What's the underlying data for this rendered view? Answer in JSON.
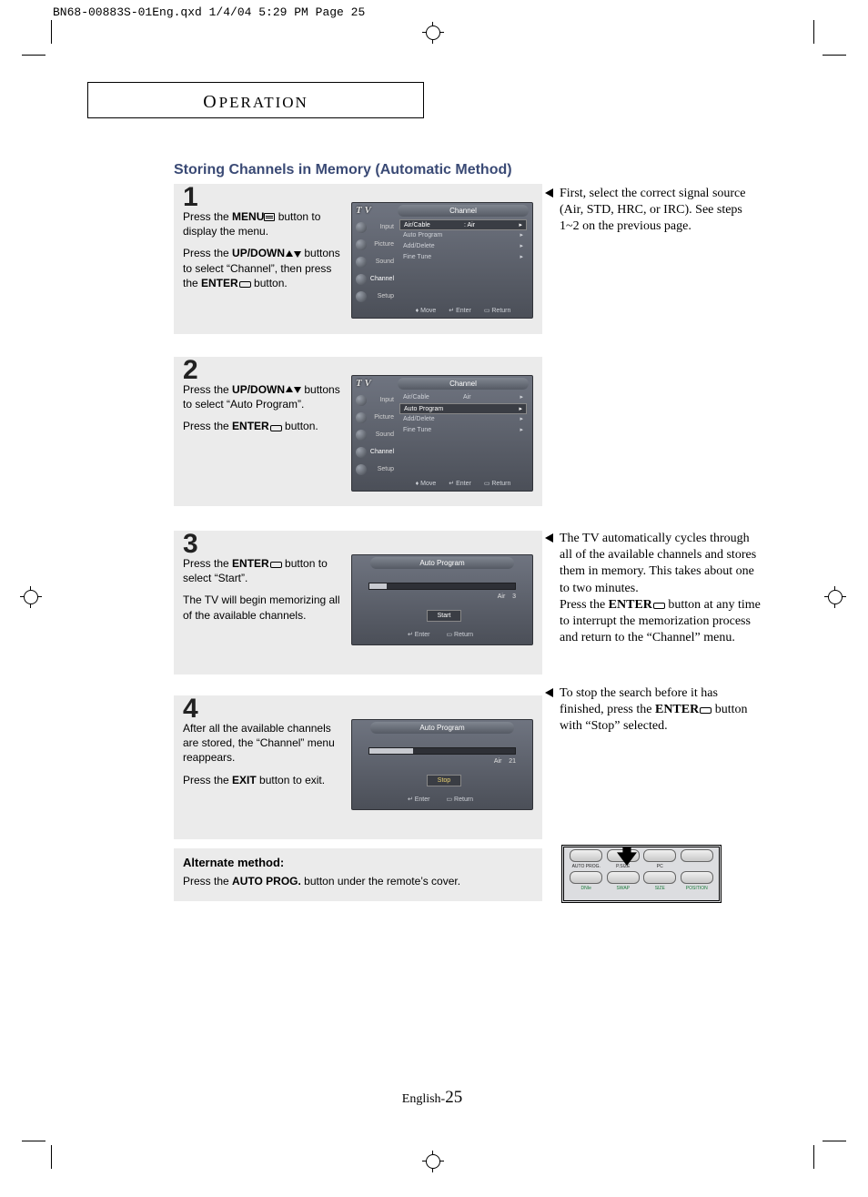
{
  "slug": "BN68-00883S-01Eng.qxd  1/4/04 5:29 PM  Page 25",
  "section_tab": "OPERATION",
  "heading": "Storing Channels in Memory (Automatic Method)",
  "steps": {
    "s1": {
      "num": "1",
      "p1a": "Press the ",
      "p1b": "MENU",
      "p1c": " button to display the menu.",
      "p2a": "Press the ",
      "p2b": "UP/DOWN",
      "p2c": " buttons to select “Channel”, then press the ",
      "p2d": "ENTER",
      "p2e": " button."
    },
    "s2": {
      "num": "2",
      "p1a": "Press the ",
      "p1b": "UP/DOWN",
      "p1c": " buttons to select “Auto Program”.",
      "p2a": "Press the ",
      "p2b": "ENTER",
      "p2c": " button."
    },
    "s3": {
      "num": "3",
      "p1a": "Press the ",
      "p1b": "ENTER",
      "p1c": " button to select “Start”.",
      "p2": "The TV will begin memorizing all of the available channels."
    },
    "s4": {
      "num": "4",
      "p1": "After all the available channels are stored, the “Channel” menu reappears.",
      "p2a": "Press the ",
      "p2b": "EXIT",
      "p2c": " button to exit."
    }
  },
  "osd": {
    "tv": "T V",
    "title": "Channel",
    "tabs": [
      "Input",
      "Picture",
      "Sound",
      "Channel",
      "Setup"
    ],
    "items1": [
      {
        "label": "Air/Cable",
        "val": ": Air",
        "arrow": "▸",
        "selected": true
      },
      {
        "label": "Auto Program",
        "arrow": "▸"
      },
      {
        "label": "Add/Delete",
        "arrow": "▸"
      },
      {
        "label": "Fine Tune",
        "arrow": "▸"
      }
    ],
    "items2": [
      {
        "label": "Air/Cable",
        "val": "Air",
        "arrow": "▸"
      },
      {
        "label": "Auto Program",
        "arrow": "▸",
        "selected": true
      },
      {
        "label": "Add/Delete",
        "arrow": "▸"
      },
      {
        "label": "Fine Tune",
        "arrow": "▸"
      }
    ],
    "footer": {
      "move": "Move",
      "enter": "Enter",
      "ret": "Return"
    }
  },
  "ap": {
    "title": "Auto Program",
    "start": "Start",
    "stop": "Stop",
    "info3_sig": "Air",
    "info3_ch": "3",
    "info4_sig": "Air",
    "info4_ch": "21",
    "enter": "Enter",
    "ret": "Return"
  },
  "notes": {
    "n1": "First, select the correct signal source (Air, STD, HRC, or IRC). See steps 1~2 on the previous page.",
    "n2a": "The TV automatically cycles through all of the available channels and stores them in memory. This takes about one to two minutes.",
    "n2b_a": "Press the ",
    "n2b_b": "ENTER",
    "n2b_c": " button at any time to interrupt the memorization process and return to the “Channel” menu.",
    "n3a": "To stop the search before it has finished, press the ",
    "n3b": "ENTER",
    "n3c": " button with “Stop” selected."
  },
  "alt": {
    "title": "Alternate method:",
    "text_a": "Press the ",
    "text_b": "AUTO PROG.",
    "text_c": " button under the remote’s cover."
  },
  "remote": {
    "row1_label": "AUTO PROG.",
    "row1_2": "P.SIZE",
    "row1_3": "PC",
    "row2_labels": [
      "DNIe",
      "SWAP",
      "SIZE",
      "POSITION"
    ]
  },
  "footer": {
    "lang": "English-",
    "num": "25"
  }
}
